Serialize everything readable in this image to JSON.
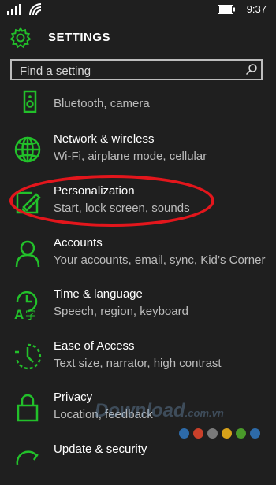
{
  "status": {
    "time": "9:37"
  },
  "header": {
    "title": "SETTINGS"
  },
  "search": {
    "placeholder": "Find a setting"
  },
  "items": [
    {
      "label": "",
      "sub": "Bluetooth, camera",
      "icon": "speaker-icon"
    },
    {
      "label": "Network & wireless",
      "sub": "Wi-Fi, airplane mode, cellular",
      "icon": "globe-icon"
    },
    {
      "label": "Personalization",
      "sub": "Start, lock screen, sounds",
      "icon": "paintbrush-icon"
    },
    {
      "label": "Accounts",
      "sub": "Your accounts, email, sync, Kid’s Corner",
      "icon": "person-icon"
    },
    {
      "label": "Time & language",
      "sub": "Speech, region, keyboard",
      "icon": "clock-language-icon"
    },
    {
      "label": "Ease of Access",
      "sub": "Text size, narrator, high contrast",
      "icon": "ease-of-access-icon"
    },
    {
      "label": "Privacy",
      "sub": "Location, feedback",
      "icon": "lock-icon"
    },
    {
      "label": "Update & security",
      "sub": "",
      "icon": "refresh-icon"
    }
  ],
  "watermark": {
    "text": "Download",
    "suffix": ".com.vn"
  },
  "colors": {
    "accent": "#22c02a",
    "highlight": "#e3161c",
    "background": "#1f1f1f",
    "subtext": "#bcbcbc"
  }
}
